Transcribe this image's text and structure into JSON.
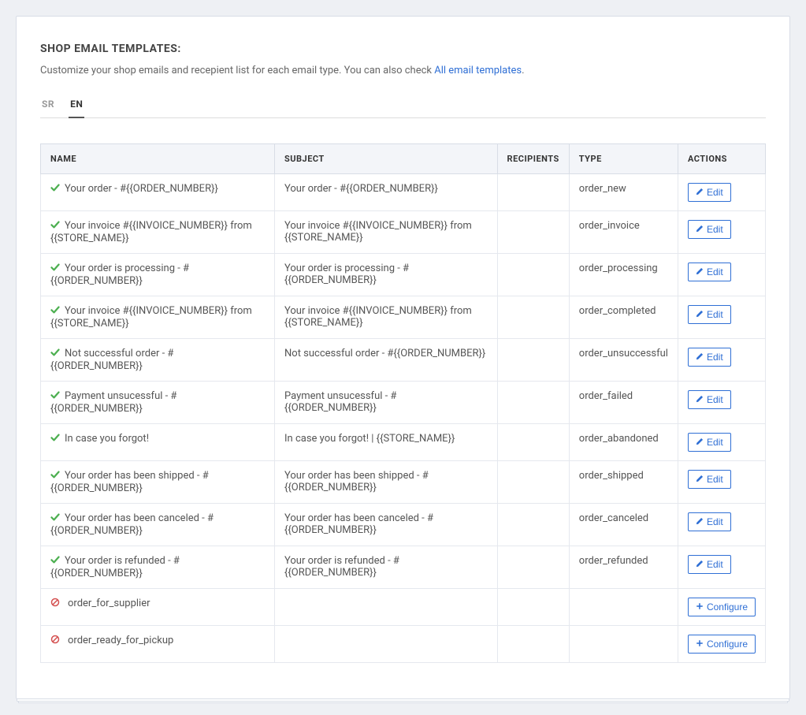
{
  "header": {
    "title": "SHOP EMAIL TEMPLATES:",
    "sub_prefix": "Customize your shop emails and recepient list for each email type. You can also check ",
    "link_label": "All email templates",
    "sub_suffix": "."
  },
  "tabs": [
    {
      "label": "SR",
      "active": false
    },
    {
      "label": "EN",
      "active": true
    }
  ],
  "table": {
    "headers": {
      "name": "NAME",
      "subject": "SUBJECT",
      "recipients": "RECIPIENTS",
      "type": "TYPE",
      "actions": "ACTIONS"
    }
  },
  "buttons": {
    "edit": "Edit",
    "configure": "Configure"
  },
  "rows": [
    {
      "status": "ok",
      "name": "Your order - #{{ORDER_NUMBER}}",
      "subject": "Your order - #{{ORDER_NUMBER}}",
      "recipients": "",
      "type": "order_new",
      "action": "edit"
    },
    {
      "status": "ok",
      "name": "Your invoice #{{INVOICE_NUMBER}} from {{STORE_NAME}}",
      "subject": "Your invoice #{{INVOICE_NUMBER}} from {{STORE_NAME}}",
      "recipients": "",
      "type": "order_invoice",
      "action": "edit"
    },
    {
      "status": "ok",
      "name": "Your order is processing - #{{ORDER_NUMBER}}",
      "subject": "Your order is processing - #{{ORDER_NUMBER}}",
      "recipients": "",
      "type": "order_processing",
      "action": "edit"
    },
    {
      "status": "ok",
      "name": "Your invoice #{{INVOICE_NUMBER}} from {{STORE_NAME}}",
      "subject": "Your invoice #{{INVOICE_NUMBER}} from {{STORE_NAME}}",
      "recipients": "",
      "type": "order_completed",
      "action": "edit"
    },
    {
      "status": "ok",
      "name": "Not successful order - #{{ORDER_NUMBER}}",
      "subject": "Not successful order - #{{ORDER_NUMBER}}",
      "recipients": "",
      "type": "order_unsuccessful",
      "action": "edit"
    },
    {
      "status": "ok",
      "name": "Payment unsucessful - #{{ORDER_NUMBER}}",
      "subject": "Payment unsucessful - #{{ORDER_NUMBER}}",
      "recipients": "",
      "type": "order_failed",
      "action": "edit"
    },
    {
      "status": "ok",
      "name": "In case you forgot!",
      "subject": "In case you forgot! | {{STORE_NAME}}",
      "recipients": "",
      "type": "order_abandoned",
      "action": "edit"
    },
    {
      "status": "ok",
      "name": "Your order has been shipped - #{{ORDER_NUMBER}}",
      "subject": "Your order has been shipped - #{{ORDER_NUMBER}}",
      "recipients": "",
      "type": "order_shipped",
      "action": "edit"
    },
    {
      "status": "ok",
      "name": "Your order has been canceled - #{{ORDER_NUMBER}}",
      "subject": "Your order has been canceled - #{{ORDER_NUMBER}}",
      "recipients": "",
      "type": "order_canceled",
      "action": "edit"
    },
    {
      "status": "ok",
      "name": "Your order is refunded - #{{ORDER_NUMBER}}",
      "subject": "Your order is refunded - #{{ORDER_NUMBER}}",
      "recipients": "",
      "type": "order_refunded",
      "action": "edit"
    },
    {
      "status": "off",
      "name": "order_for_supplier",
      "subject": "",
      "recipients": "",
      "type": "",
      "action": "configure"
    },
    {
      "status": "off",
      "name": "order_ready_for_pickup",
      "subject": "",
      "recipients": "",
      "type": "",
      "action": "configure"
    }
  ]
}
